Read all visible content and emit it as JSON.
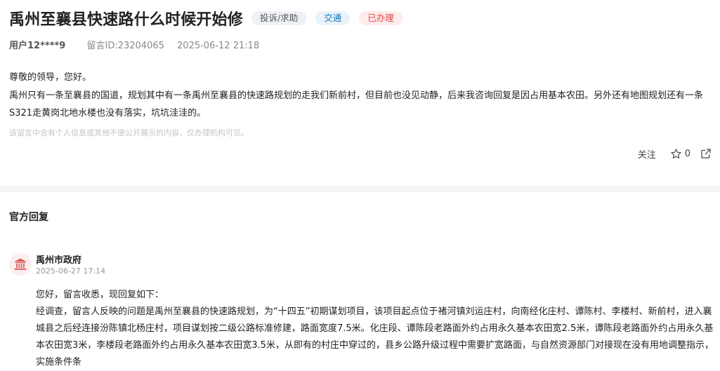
{
  "post": {
    "title": "禹州至襄县快速路什么时候开始修",
    "tags": {
      "category": "投诉/求助",
      "topic": "交通",
      "status": "已办理"
    },
    "user": "用户12****9",
    "message_id": "留言ID:23204065",
    "datetime": "2025-06-12 21:18",
    "greeting": "尊敬的领导，您好。",
    "body": "禹州只有一条至襄县的国道，规划其中有一条禹州至襄县的快速路规划的走我们新前村，但目前也没见动静，后来我咨询回复是因占用基本农田。另外还有地图规划还有一条S321走黄岗北地水楼也没有落实，坑坑洼洼的。",
    "privacy_note": "该留言中含有个人信息或其他不便公开展示的内容，仅办理机构可见。"
  },
  "actions": {
    "follow_label": "关注",
    "star_count": "0",
    "star_icon": "star-outline",
    "share_icon": "share-external"
  },
  "official": {
    "section_title": "官方回复",
    "org_name": "禹州市政府",
    "org_icon": "government-building",
    "date": "2025-06-27 17:14",
    "greeting": "您好，留言收悉，现回复如下：",
    "body": "经调查，留言人反映的问题是禹州至襄县的快速路规划，为“十四五”初期谋划项目，该项目起点位于褚河镇刘运庄村，向南经化庄村、谭陈村、李楼村、新前村，进入襄城县之后经连接汾陈镇北杨庄村，项目谋划按二级公路标准修建，路面宽度7.5米。化庄段、谭陈段老路面外约占用永久基本农田宽2.5米，谭陈段老路面外约占用永久基本农田宽3米，李楼段老路面外约占用永久基本农田宽3.5米，从即有的村庄中穿过的，县乡公路升级过程中需要扩宽路面，与自然资源部门对接现在没有用地调整指示，实施条件条"
  },
  "colors": {
    "status_red": "#e04848",
    "topic_blue": "#1976b8",
    "accent_red": "#d9534f"
  }
}
